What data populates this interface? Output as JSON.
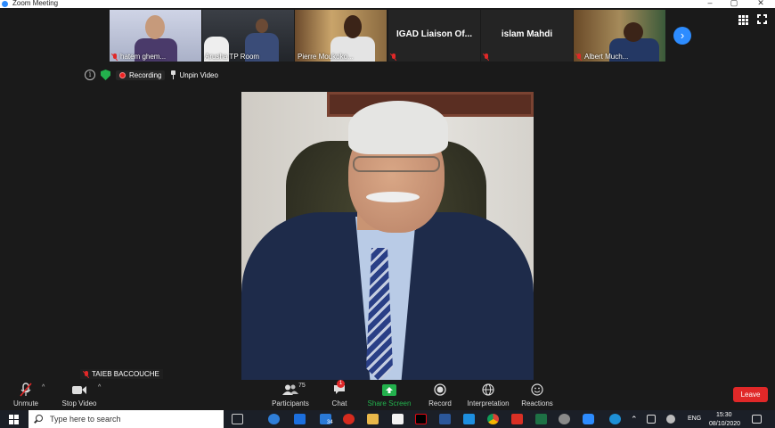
{
  "window": {
    "title": "Zoom Meeting"
  },
  "gallery": {
    "tiles": [
      {
        "name": "hatem ghem..."
      },
      {
        "name": "Arusha TP Room"
      },
      {
        "name": "Pierre Moukoko..."
      },
      {
        "label": "IGAD Liaison Of..."
      },
      {
        "label": "islam Mahdi"
      },
      {
        "name": "Albert Much..."
      }
    ],
    "next_symbol": "›"
  },
  "status": {
    "info_symbol": "i",
    "recording_label": "Recording",
    "unpin_label": "Unpin Video"
  },
  "speaker": {
    "name": "TAIEB BACCOUCHE"
  },
  "toolbar": {
    "unmute": "Unmute",
    "stop_video": "Stop Video",
    "participants": "Participants",
    "participant_count": "75",
    "chat": "Chat",
    "chat_badge": "1",
    "share_screen": "Share Screen",
    "record": "Record",
    "interpretation": "Interpretation",
    "reactions": "Reactions",
    "leave": "Leave",
    "caret": "^"
  },
  "taskbar": {
    "search_placeholder": "Type here to search",
    "language": "ENG",
    "time": "15:30",
    "date": "08/10/2020",
    "mail_count": "34"
  },
  "colors": {
    "accent": "#2d8cff",
    "leave": "#e02828",
    "share": "#23b14d",
    "background": "#1a1a1a"
  }
}
